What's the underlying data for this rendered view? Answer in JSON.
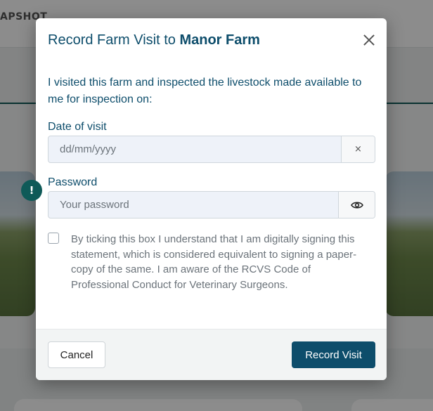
{
  "background": {
    "brand_fragment": "APSHOT",
    "alert_icon_glyph": "!"
  },
  "modal": {
    "title_prefix": "Record Farm Visit to ",
    "farm_name": "Manor Farm",
    "intro_text": "I visited this farm and inspected the livestock made available to me for inspection on:",
    "date_field": {
      "label": "Date of visit",
      "value": "",
      "placeholder": "dd/mm/yyyy",
      "clear_glyph": "×"
    },
    "password_field": {
      "label": "Password",
      "value": "",
      "placeholder": "Your password",
      "toggle_icon": "eye-icon"
    },
    "consent": {
      "checked": false,
      "text": "By ticking this box I understand that I am digitally signing this statement, which is considered equivalent to signing a paper-copy of the same. I am aware of the RCVS Code of Professional Conduct for Veterinary Surgeons."
    },
    "footer": {
      "cancel_label": "Cancel",
      "submit_label": "Record Visit"
    }
  },
  "colors": {
    "primary": "#0d4d6b",
    "teal_accent": "#0f5a58",
    "input_bg": "#eef2f9"
  }
}
